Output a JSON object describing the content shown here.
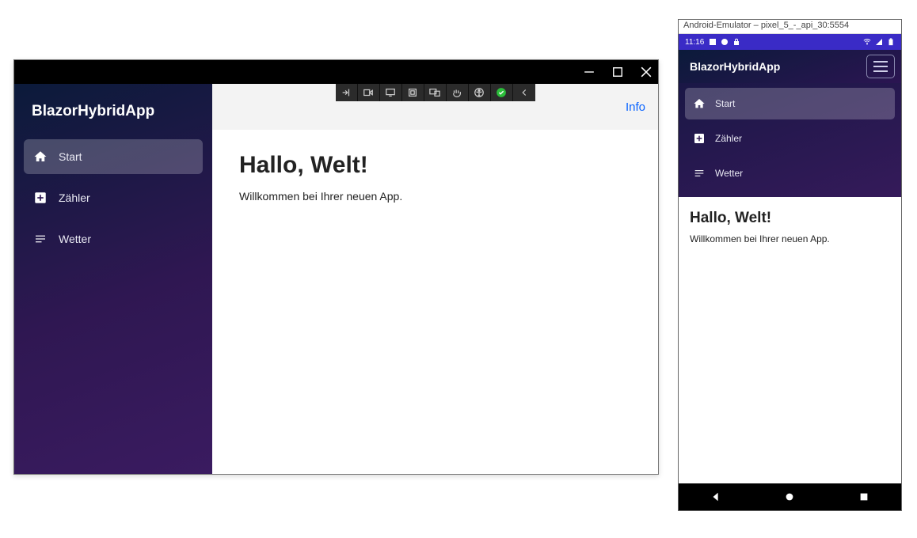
{
  "desktop": {
    "brand": "BlazorHybridApp",
    "nav": {
      "start": {
        "label": "Start",
        "active": true
      },
      "zahler": {
        "label": "Zähler",
        "active": false
      },
      "wetter": {
        "label": "Wetter",
        "active": false
      }
    },
    "info_link": "Info",
    "page": {
      "heading": "Hallo, Welt!",
      "subheading": "Willkommen bei Ihrer neuen App."
    }
  },
  "emulator": {
    "window_title": "Android-Emulator – pixel_5_-_api_30:5554",
    "status_time": "11:16",
    "brand": "BlazorHybridApp",
    "nav": {
      "start": {
        "label": "Start",
        "active": true
      },
      "zahler": {
        "label": "Zähler",
        "active": false
      },
      "wetter": {
        "label": "Wetter",
        "active": false
      }
    },
    "page": {
      "heading": "Hallo, Welt!",
      "subheading": "Willkommen bei Ihrer neuen App."
    }
  },
  "colors": {
    "sidebar_gradient_from": "#0b1a3a",
    "sidebar_gradient_to": "#3a1b60",
    "active_nav_bg": "rgba(255,255,255,0.22)",
    "info_link": "#0a64ff",
    "statusbar": "#3a2bc6"
  }
}
